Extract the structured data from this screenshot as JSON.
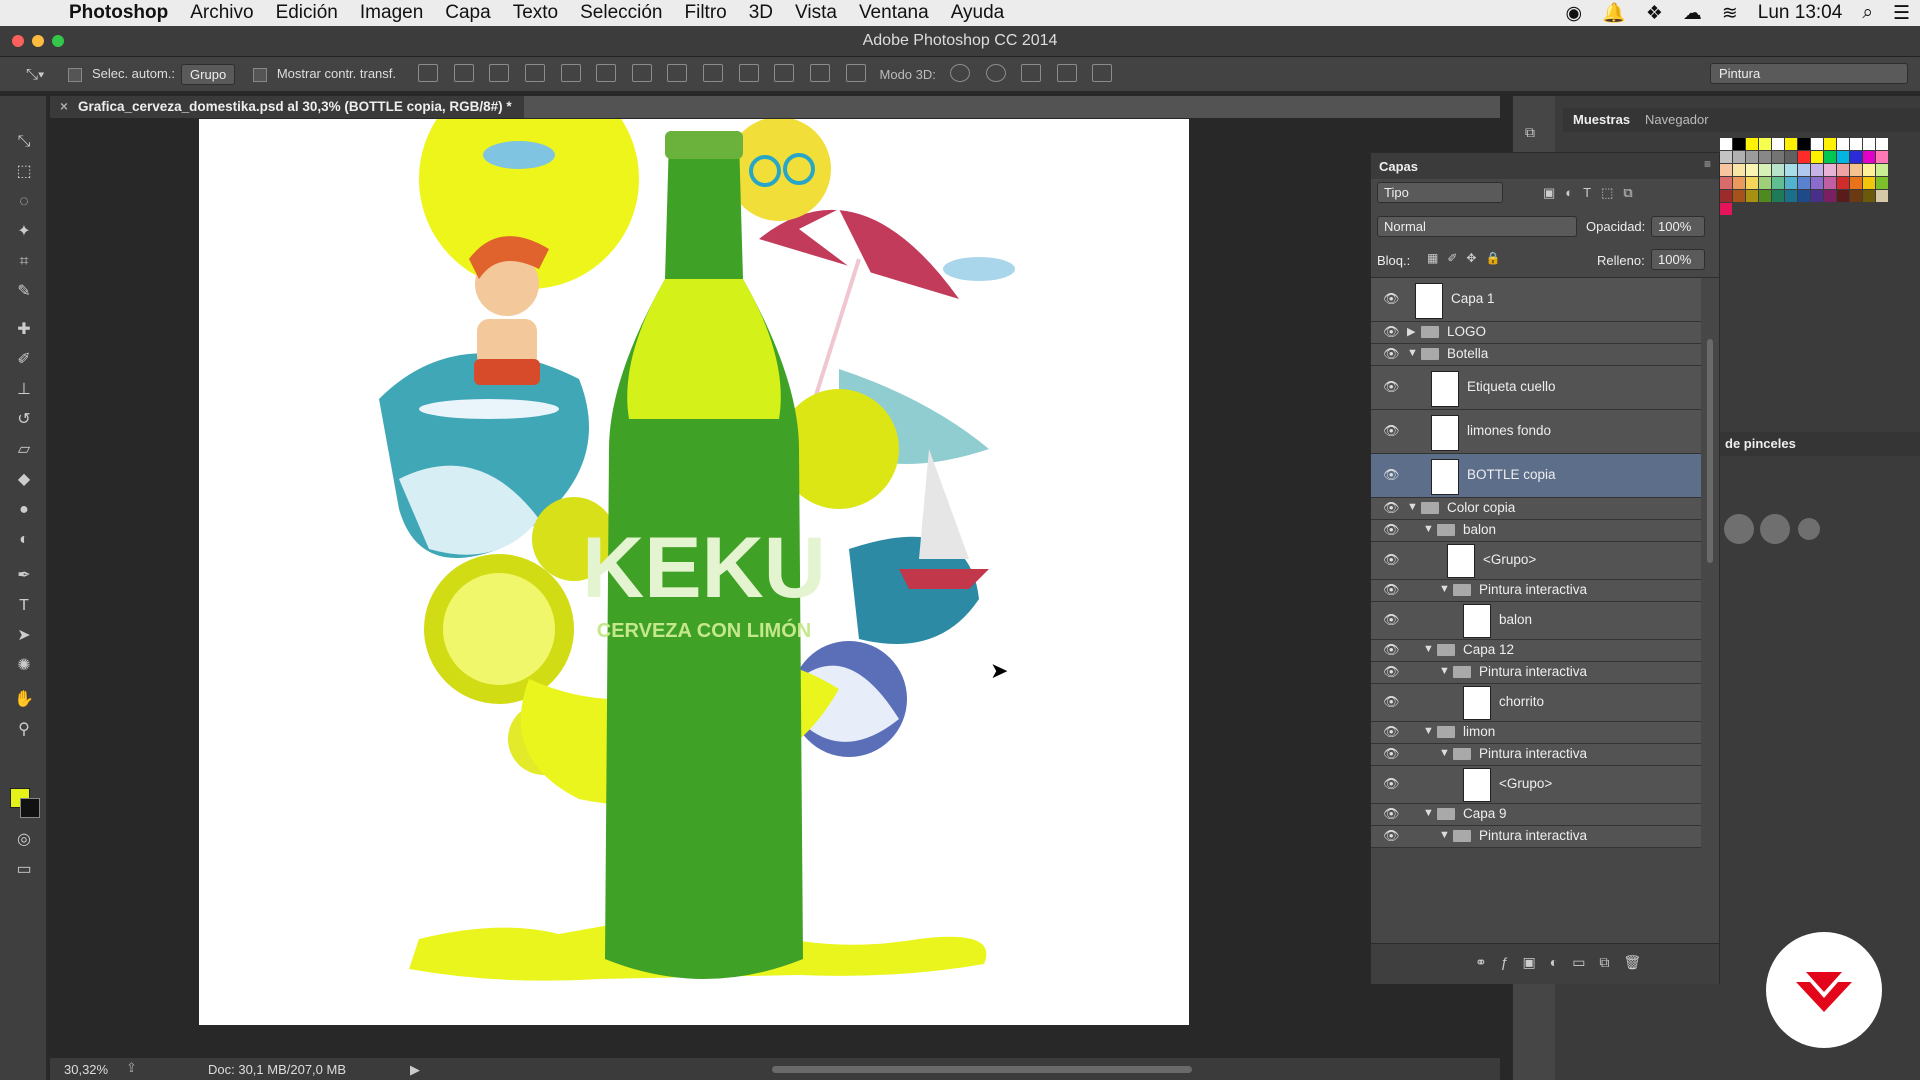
{
  "menubar": {
    "app": "Photoshop",
    "items": [
      "Archivo",
      "Edición",
      "Imagen",
      "Capa",
      "Texto",
      "Selección",
      "Filtro",
      "3D",
      "Vista",
      "Ventana",
      "Ayuda"
    ],
    "clock": "Lun 13:04"
  },
  "window": {
    "title": "Adobe Photoshop CC 2014"
  },
  "options": {
    "auto_select_label": "Selec. autom.:",
    "auto_select_value": "Grupo",
    "show_transform_label": "Mostrar contr. transf.",
    "mode3d_label": "Modo 3D:",
    "workspace": "Pintura"
  },
  "document": {
    "tab_title": "Grafica_cerveza_domestika.psd al 30,3% (BOTTLE copia, RGB/8#) *",
    "zoom": "30,32%",
    "doc_info": "Doc: 30,1 MB/207,0 MB"
  },
  "artwork": {
    "brand": "KEKU",
    "tagline": "CERVEZA CON LIMÓN"
  },
  "panels": {
    "muestras_tab": "Muestras",
    "navegador_tab": "Navegador",
    "pinceles_title": "de pinceles"
  },
  "layers_panel": {
    "title": "Capas",
    "kind_filter": "Tipo",
    "blend_mode": "Normal",
    "opacity_label": "Opacidad:",
    "opacity_value": "100%",
    "lock_label": "Bloq.:",
    "fill_label": "Relleno:",
    "fill_value": "100%",
    "layers": [
      {
        "name": "Capa 1"
      },
      {
        "name": "LOGO"
      },
      {
        "name": "Botella"
      },
      {
        "name": "Etiqueta cuello"
      },
      {
        "name": "limones fondo"
      },
      {
        "name": "BOTTLE copia"
      },
      {
        "name": "Color copia"
      },
      {
        "name": "balon"
      },
      {
        "name": "<Grupo>"
      },
      {
        "name": "Pintura interactiva"
      },
      {
        "name": "balon"
      },
      {
        "name": "Capa 12"
      },
      {
        "name": "Pintura interactiva"
      },
      {
        "name": "chorrito"
      },
      {
        "name": "limon"
      },
      {
        "name": "Pintura interactiva"
      },
      {
        "name": "<Grupo>"
      },
      {
        "name": "Capa 9"
      },
      {
        "name": "Pintura interactiva"
      }
    ]
  },
  "colors": {
    "foreground": "#e4f21a",
    "background": "#111111",
    "selection": "#5d6e8a"
  }
}
